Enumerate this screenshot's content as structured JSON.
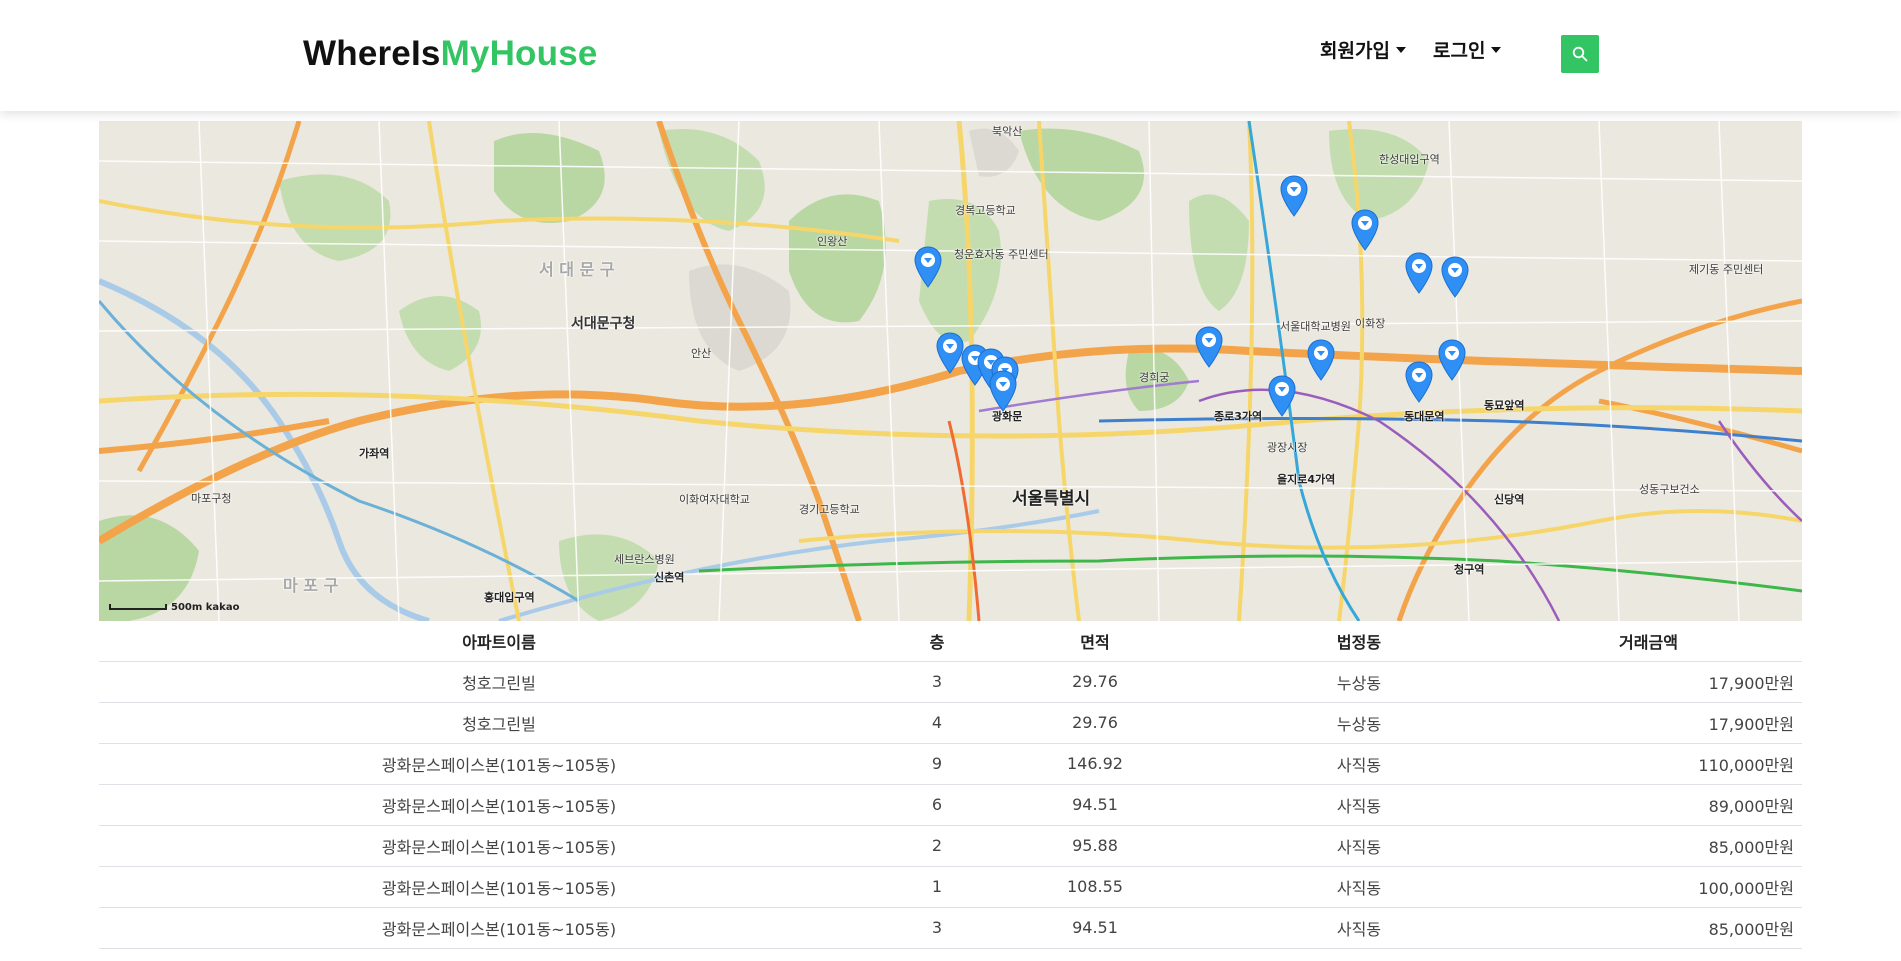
{
  "header": {
    "logo_part1": "WhereIs",
    "logo_part2": "MyHouse",
    "nav_signup": "회원가입",
    "nav_login": "로그인",
    "search_icon": "search-icon",
    "accent_color": "#33c463"
  },
  "map": {
    "labels": {
      "city": "서울특별시",
      "seodaemun_gu": "서대문구청",
      "seodaemun_district": "서 대 문 구",
      "mapo_district": "마 포 구",
      "jongno_hospital": "서울대학교병원",
      "hyehwa": "이화장",
      "cheongwadae": "청운효자동 주민센터",
      "gyeongbok_hs": "경복고등학교",
      "anguk": "안국",
      "gyeonghuigung": "경희궁",
      "gwanghwamun": "광화문",
      "jongno3ga": "종로3가역",
      "dongdaemun": "동대문역",
      "sinchon": "신촌역",
      "ewha": "이화여자대학교",
      "yonsei": "세브란스병원",
      "sungdong": "성동구보건소",
      "jegi": "제기동 주민센터",
      "mapo_gu": "마포구청",
      "gajwa": "가좌역",
      "hongdae": "홍대입구역",
      "euljiro4ga": "을지로4가역",
      "gwangjang": "광장시장",
      "sindang": "신당역",
      "cheonggu": "청구역",
      "dongmyo": "동묘앞역",
      "hansung": "한성대입구역",
      "gyeonggi_hs": "경기고등학교",
      "inwangsan": "인왕산",
      "ansan": "안산",
      "bugaksan": "북악산",
      "scale": "500m",
      "brand": "kakao"
    }
  },
  "table": {
    "headers": [
      "아파트이름",
      "층",
      "면적",
      "법정동",
      "거래금액"
    ],
    "rows": [
      {
        "name": "청호그린빌",
        "floor": "3",
        "area": "29.76",
        "dong": "누상동",
        "price": "17,900만원"
      },
      {
        "name": "청호그린빌",
        "floor": "4",
        "area": "29.76",
        "dong": "누상동",
        "price": "17,900만원"
      },
      {
        "name": "광화문스페이스본(101동~105동)",
        "floor": "9",
        "area": "146.92",
        "dong": "사직동",
        "price": "110,000만원"
      },
      {
        "name": "광화문스페이스본(101동~105동)",
        "floor": "6",
        "area": "94.51",
        "dong": "사직동",
        "price": "89,000만원"
      },
      {
        "name": "광화문스페이스본(101동~105동)",
        "floor": "2",
        "area": "95.88",
        "dong": "사직동",
        "price": "85,000만원"
      },
      {
        "name": "광화문스페이스본(101동~105동)",
        "floor": "1",
        "area": "108.55",
        "dong": "사직동",
        "price": "100,000만원"
      },
      {
        "name": "광화문스페이스본(101동~105동)",
        "floor": "3",
        "area": "94.51",
        "dong": "사직동",
        "price": "85,000만원"
      }
    ]
  }
}
